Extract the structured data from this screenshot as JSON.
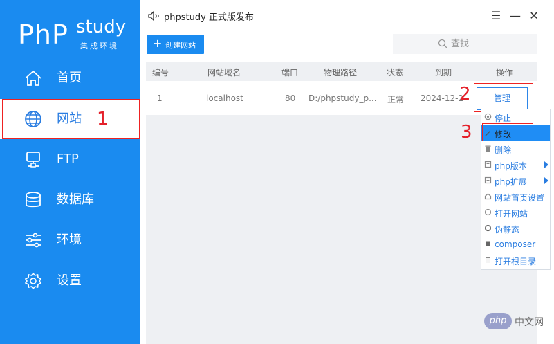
{
  "app": {
    "logo_php": "PhP",
    "logo_study": "study",
    "logo_sub": "集成环境",
    "title": "phpstudy 正式版发布"
  },
  "sidebar": {
    "items": [
      {
        "label": "首页",
        "icon": "home-icon"
      },
      {
        "label": "网站",
        "icon": "globe-icon"
      },
      {
        "label": "FTP",
        "icon": "server-icon"
      },
      {
        "label": "数据库",
        "icon": "database-icon"
      },
      {
        "label": "环境",
        "icon": "sliders-icon"
      },
      {
        "label": "设置",
        "icon": "gear-icon"
      }
    ],
    "active_index": 1
  },
  "window": {
    "minimize": "—",
    "menu": "☰",
    "close": "✕"
  },
  "toolbar": {
    "create_label": "创建网站",
    "create_icon": "+",
    "search_placeholder": "查找"
  },
  "table": {
    "headers": [
      "编号",
      "网站域名",
      "端口",
      "物理路径",
      "状态",
      "到期",
      "操作"
    ],
    "rows": [
      {
        "id": "1",
        "domain": "localhost",
        "port": "80",
        "path": "D:/phpstudy_p...",
        "status": "正常",
        "expiry": "2024-12-2",
        "action": "管理"
      }
    ]
  },
  "context_menu": {
    "items": [
      {
        "label": "停止",
        "icon": "stop-icon"
      },
      {
        "label": "修改",
        "icon": "pencil-icon",
        "highlighted": true
      },
      {
        "label": "删除",
        "icon": "trash-icon"
      },
      {
        "label": "php版本",
        "icon": "php-version-icon",
        "submenu": true
      },
      {
        "label": "php扩展",
        "icon": "php-extension-icon",
        "submenu": true
      },
      {
        "label": "网站首页设置",
        "icon": "home-settings-icon"
      },
      {
        "label": "打开网站",
        "icon": "open-site-icon"
      },
      {
        "label": "伪静态",
        "icon": "rewrite-icon"
      },
      {
        "label": "composer",
        "icon": "composer-icon"
      },
      {
        "label": "打开根目录",
        "icon": "folder-list-icon"
      }
    ]
  },
  "annotations": {
    "step1": "1",
    "step2": "2",
    "step3": "3"
  },
  "watermark": {
    "badge": "php",
    "text": "中文网"
  },
  "colors": {
    "sidebar_bg": "#1a8bf0",
    "accent": "#2a7de1",
    "annotation_red": "#e4202a",
    "menu_highlight": "#1f8df5"
  }
}
